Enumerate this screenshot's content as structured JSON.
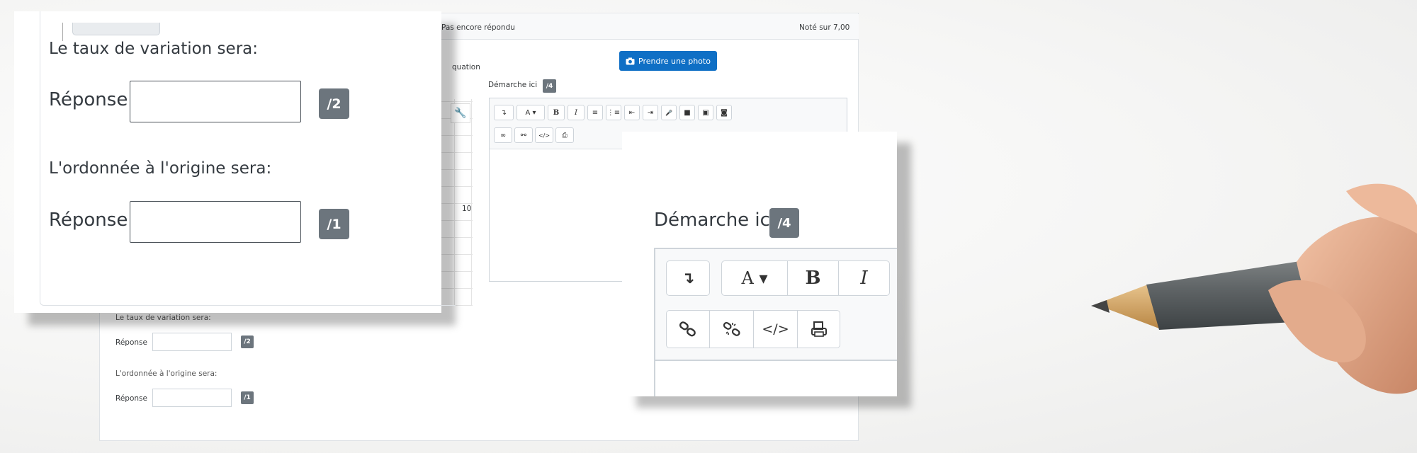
{
  "question": {
    "status": "Pas encore répondu",
    "grade": "Noté sur 7,00",
    "clipped_text": "quation",
    "photo_button": "Prendre une photo",
    "axis_tick": "10"
  },
  "steps": {
    "label": "Démarche ici",
    "points": "/4"
  },
  "editor_toolbar": {
    "row1": [
      {
        "icon": "indent-icon",
        "glyph": "↴"
      },
      {
        "icon": "font-color-icon",
        "glyph": "A ▾"
      },
      {
        "icon": "bold-icon",
        "glyph": "B"
      },
      {
        "icon": "italic-icon",
        "glyph": "I"
      },
      {
        "icon": "unordered-list-icon",
        "glyph": "≡"
      },
      {
        "icon": "ordered-list-icon",
        "glyph": "⋮≡"
      },
      {
        "icon": "outdent-icon",
        "glyph": "⇤"
      },
      {
        "icon": "indent-more-icon",
        "glyph": "⇥"
      },
      {
        "icon": "microphone-icon",
        "glyph": "🎤"
      },
      {
        "icon": "video-icon",
        "glyph": "■"
      },
      {
        "icon": "image-icon",
        "glyph": "▣"
      },
      {
        "icon": "screenshot-icon",
        "glyph": "◙"
      }
    ],
    "row2": [
      {
        "icon": "link-icon",
        "glyph": "∞"
      },
      {
        "icon": "unlink-icon",
        "glyph": "⚯"
      },
      {
        "icon": "code-icon",
        "glyph": "</>"
      },
      {
        "icon": "print-icon",
        "glyph": "⎙"
      }
    ]
  },
  "answers": [
    {
      "label": "Le taux de variation sera:",
      "response_label": "Réponse",
      "value": "",
      "points": "/2"
    },
    {
      "label": "L'ordonnée à l'origine sera:",
      "response_label": "Réponse",
      "value": "",
      "points": "/1"
    }
  ],
  "colors": {
    "accent": "#0f6fc5",
    "badge": "#6c757d"
  }
}
